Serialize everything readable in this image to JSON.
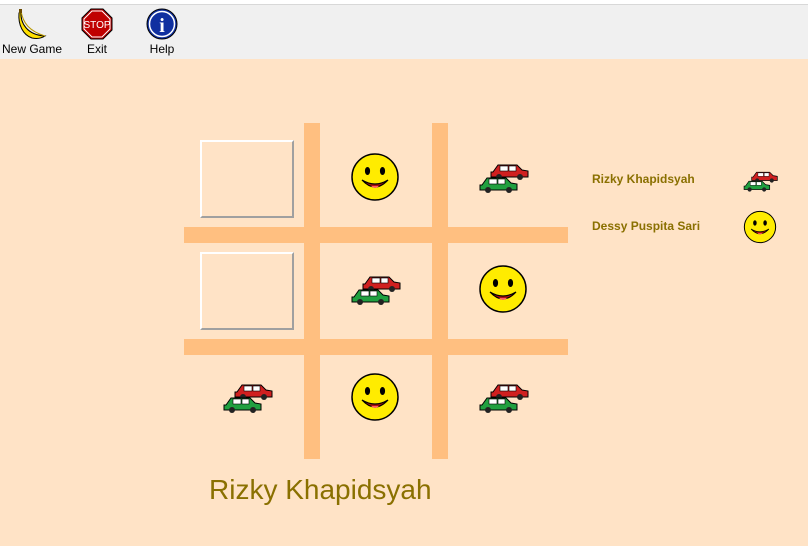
{
  "toolbar": {
    "new_game": {
      "label": "New Game",
      "icon": "banana-icon"
    },
    "exit": {
      "label": "Exit",
      "icon": "stop-sign-icon",
      "sign_text": "STOP"
    },
    "help": {
      "label": "Help",
      "icon": "info-icon",
      "glyph": "i"
    }
  },
  "board": {
    "cells": [
      {
        "index": 0,
        "mark": "empty"
      },
      {
        "index": 1,
        "mark": "smiley"
      },
      {
        "index": 2,
        "mark": "cars"
      },
      {
        "index": 3,
        "mark": "empty"
      },
      {
        "index": 4,
        "mark": "cars"
      },
      {
        "index": 5,
        "mark": "smiley"
      },
      {
        "index": 6,
        "mark": "cars"
      },
      {
        "index": 7,
        "mark": "smiley"
      },
      {
        "index": 8,
        "mark": "cars"
      }
    ]
  },
  "players": [
    {
      "name": "Rizky Khapidsyah",
      "mark": "cars"
    },
    {
      "name": "Dessy Puspita Sari",
      "mark": "smiley"
    }
  ],
  "current_player": "Rizky Khapidsyah",
  "colors": {
    "background": "#ffe3c6",
    "grid": "#ffbf80",
    "text": "#8a7000",
    "smiley": "#ffec00",
    "car_red": "#d02020",
    "car_green": "#20a040"
  }
}
